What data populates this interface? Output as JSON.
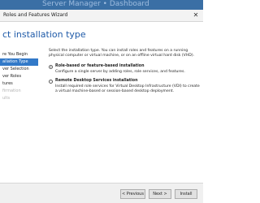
{
  "background": {
    "behind_text": "Server Manager • Dashboard"
  },
  "window": {
    "title": "Roles and Features Wizard",
    "close_glyph": "✕"
  },
  "header": {
    "page_title": "ct installation type"
  },
  "nav": {
    "items": [
      {
        "label": "re You Begin",
        "state": "normal"
      },
      {
        "label": "allation Type",
        "state": "active"
      },
      {
        "label": "ver Selection",
        "state": "normal"
      },
      {
        "label": "ver Roles",
        "state": "normal"
      },
      {
        "label": "tures",
        "state": "normal"
      },
      {
        "label": "firmation",
        "state": "disabled"
      },
      {
        "label": "ults",
        "state": "disabled"
      }
    ]
  },
  "content": {
    "intro": "Select the installation type. You can install roles and features on a running physical computer or virtual machine, or on an offline virtual hard disk (VHD).",
    "options": [
      {
        "title": "Role-based or feature-based installation",
        "description": "Configure a single server by adding roles, role services, and features.",
        "selected": true
      },
      {
        "title": "Remote Desktop Services installation",
        "description": "Install required role services for Virtual Desktop Infrastructure (VDI) to create a virtual machine-based or session-based desktop deployment.",
        "selected": false
      }
    ]
  },
  "footer": {
    "previous_label": "< Previous",
    "next_label": "Next >",
    "install_label": "Install"
  },
  "colors": {
    "accent": "#3279c8",
    "title_blue": "#1e5aa8",
    "window_strip": "#3a6fa5"
  }
}
